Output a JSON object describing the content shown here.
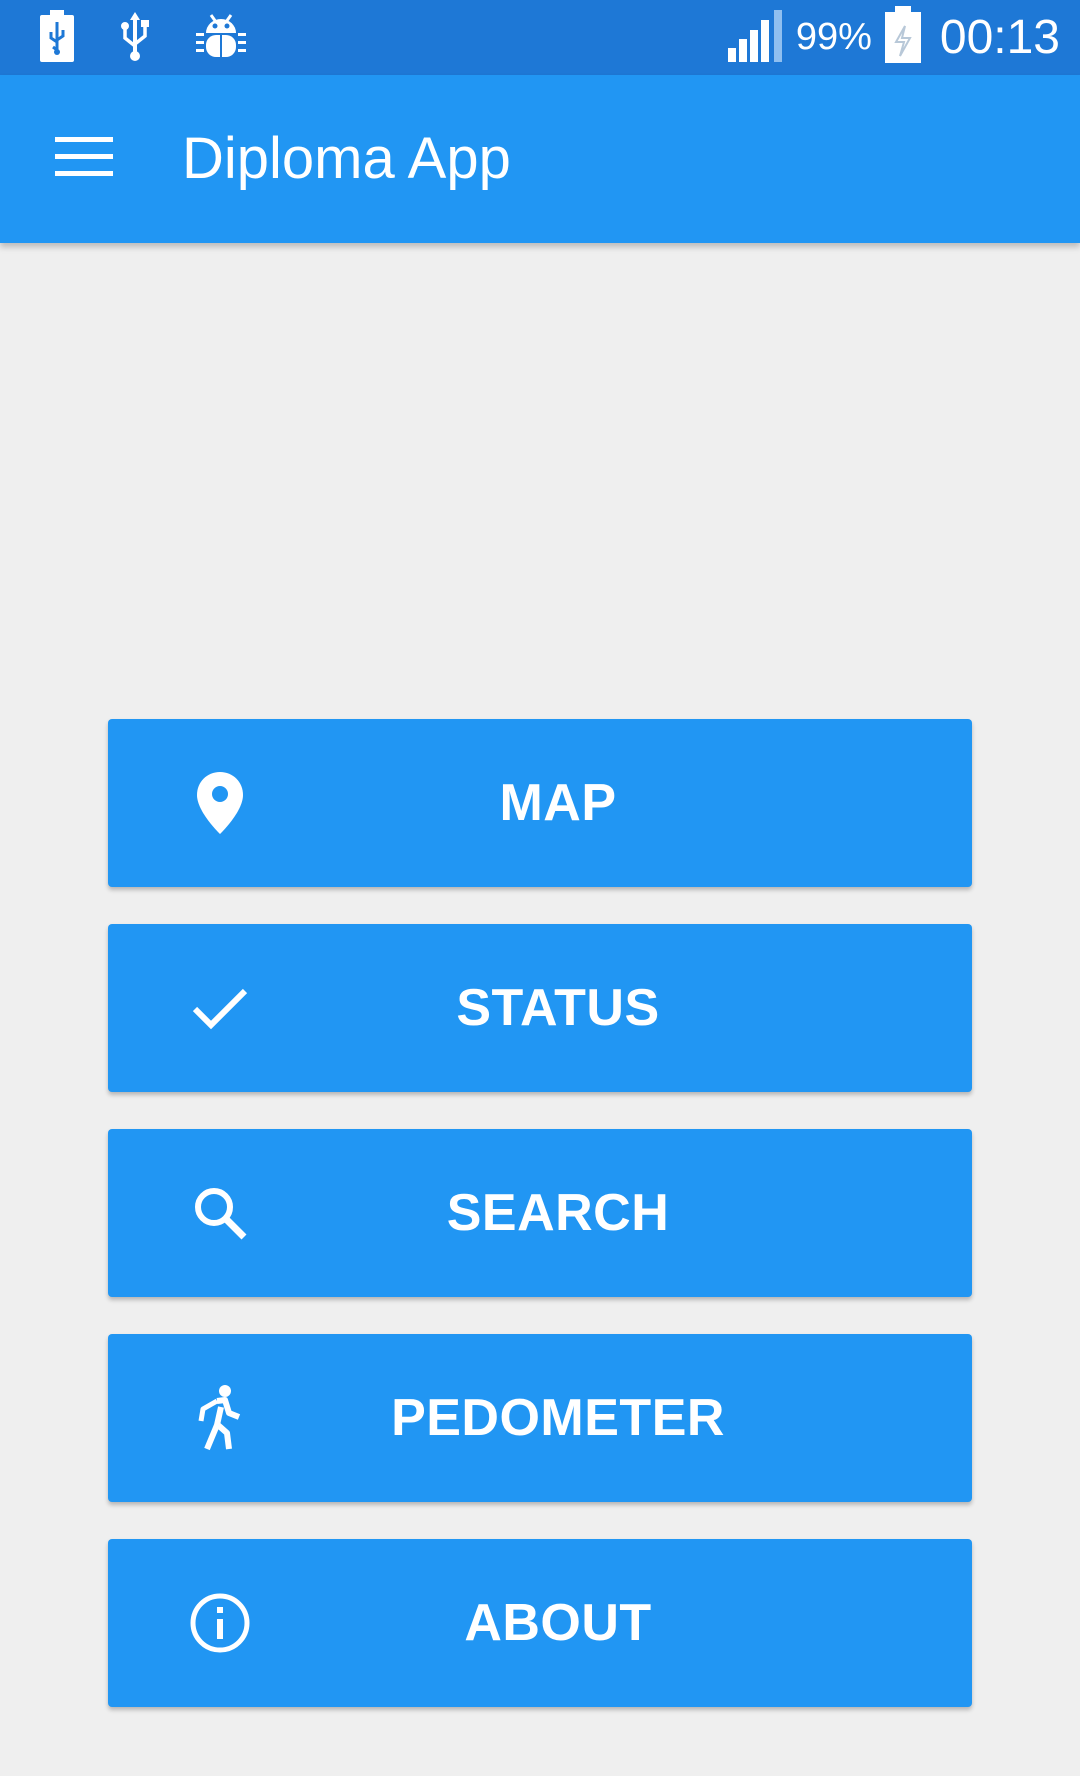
{
  "status_bar": {
    "battery_percent": "99%",
    "time": "00:13",
    "icons": [
      "battery-usb-icon",
      "usb-icon",
      "android-debug-icon",
      "signal-icon",
      "battery-charging-icon"
    ]
  },
  "app_bar": {
    "title": "Diploma App",
    "menu_icon": "hamburger-menu-icon"
  },
  "menu": {
    "buttons": [
      {
        "label": "MAP",
        "icon": "location-pin-icon"
      },
      {
        "label": "STATUS",
        "icon": "checkmark-icon"
      },
      {
        "label": "SEARCH",
        "icon": "search-icon"
      },
      {
        "label": "PEDOMETER",
        "icon": "walking-person-icon"
      },
      {
        "label": "ABOUT",
        "icon": "info-icon"
      }
    ]
  },
  "colors": {
    "status_bar": "#1e78d6",
    "primary": "#2196f3",
    "background": "#efefef",
    "on_primary": "#ffffff"
  }
}
